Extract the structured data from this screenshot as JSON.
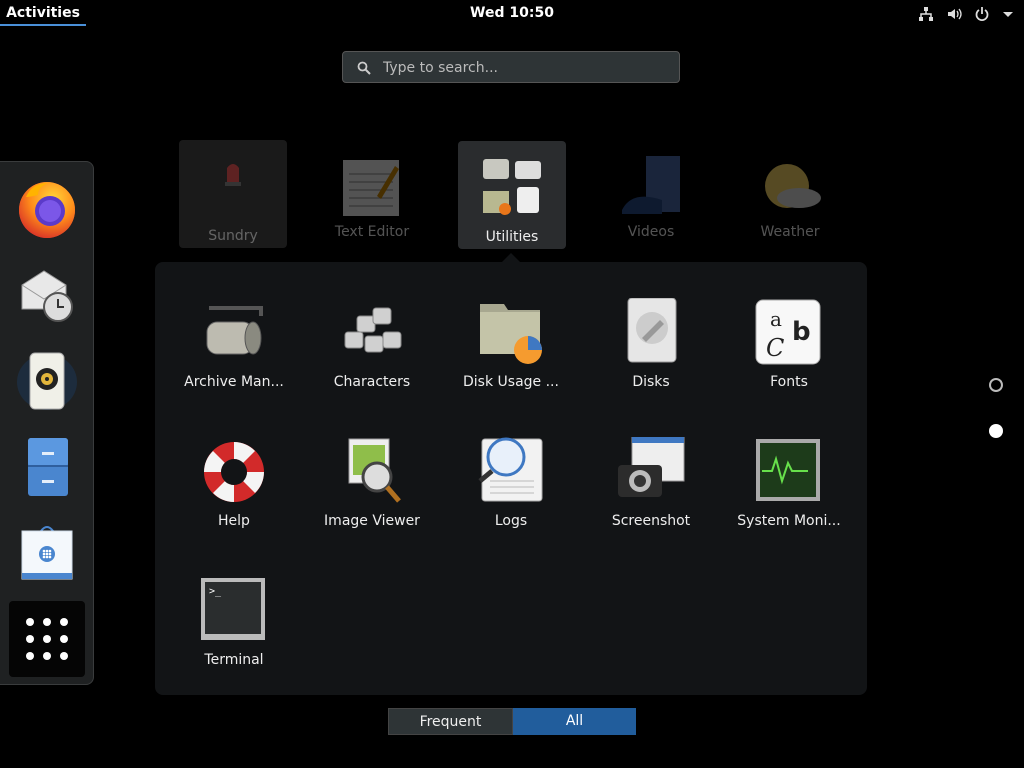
{
  "topbar": {
    "activities": "Activities",
    "clock": "Wed 10:50",
    "tray": [
      "network-icon",
      "volume-icon",
      "power-icon",
      "dropdown-arrow-icon"
    ]
  },
  "search": {
    "placeholder": "Type to search..."
  },
  "dash": {
    "items": [
      "firefox",
      "evolution-mail-calendar",
      "rhythmbox",
      "files",
      "software",
      "show-applications"
    ]
  },
  "folders": [
    {
      "label": "Sundry"
    },
    {
      "label": "Text Editor"
    },
    {
      "label": "Utilities"
    },
    {
      "label": "Videos"
    },
    {
      "label": "Weather"
    }
  ],
  "utilities": {
    "apps": [
      {
        "label": "Archive Man..."
      },
      {
        "label": "Characters"
      },
      {
        "label": "Disk Usage ..."
      },
      {
        "label": "Disks"
      },
      {
        "label": "Fonts"
      },
      {
        "label": "Help"
      },
      {
        "label": "Image Viewer"
      },
      {
        "label": "Logs"
      },
      {
        "label": "Screenshot"
      },
      {
        "label": "System Moni..."
      },
      {
        "label": "Terminal"
      }
    ]
  },
  "view_switch": {
    "frequent": "Frequent",
    "all": "All",
    "active": "All"
  },
  "colors": {
    "accent": "#215d9c",
    "topbar_accent": "#4a90d9",
    "popup_bg": "#121416"
  }
}
